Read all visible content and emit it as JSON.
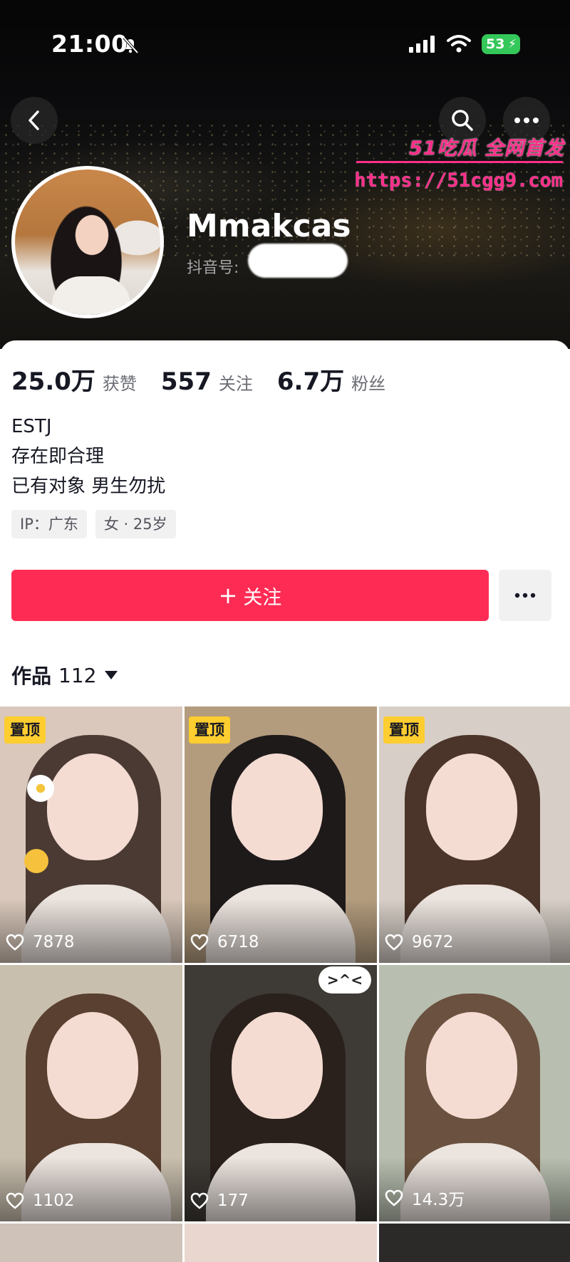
{
  "status_bar": {
    "time": "21:00",
    "battery": "53"
  },
  "watermark": {
    "title": "51吃瓜 全网首发",
    "url": "https://51cgg9.com"
  },
  "profile": {
    "nickname": "Mmakcas",
    "douyin_id_label": "抖音号:",
    "stats": [
      {
        "value": "25.0万",
        "label": "获赞"
      },
      {
        "value": "557",
        "label": "关注"
      },
      {
        "value": "6.7万",
        "label": "粉丝"
      }
    ],
    "bio_lines": [
      "ESTJ",
      "存在即合理",
      "已有对象 男生勿扰"
    ],
    "tags": [
      "IP：广东",
      "女 · 25岁"
    ]
  },
  "actions": {
    "follow_label": "关注",
    "follow_plus": "+"
  },
  "works": {
    "label": "作品",
    "count": "112"
  },
  "grid": [
    {
      "pinned": true,
      "pin_label": "置顶",
      "likes": "7878",
      "bg": "#d9c8bb",
      "hair": "#4a3a33"
    },
    {
      "pinned": true,
      "pin_label": "置顶",
      "likes": "6718",
      "bg": "#b39c7e",
      "hair": "#1e1a1a"
    },
    {
      "pinned": true,
      "pin_label": "置顶",
      "likes": "9672",
      "bg": "#d7cfc7",
      "hair": "#4b3429"
    },
    {
      "pinned": false,
      "pin_label": "",
      "likes": "1102",
      "bg": "#c9bfae",
      "hair": "#5a4030"
    },
    {
      "pinned": false,
      "pin_label": "",
      "likes": "177",
      "bg": "#3e3a36",
      "hair": "#2a201c",
      "bubble": ">^<"
    },
    {
      "pinned": false,
      "pin_label": "",
      "likes": "14.3万",
      "bg": "#b8bfb0",
      "hair": "#6b513f"
    }
  ],
  "colors": {
    "accent": "#fe2c55",
    "pin_badge": "#fecd2f",
    "watermark": "#ff2e8a"
  }
}
